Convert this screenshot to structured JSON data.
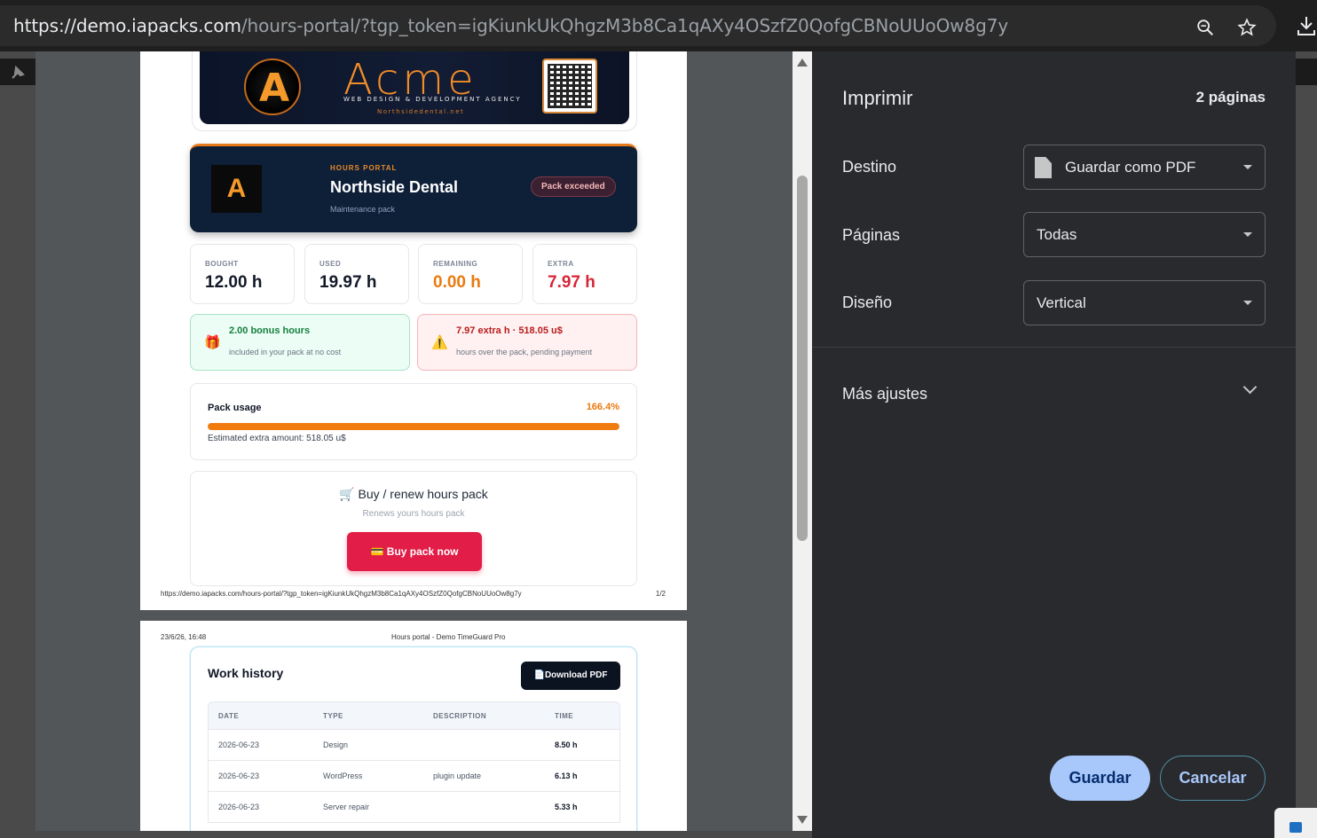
{
  "browser": {
    "url_host": "https://demo.iapacks.com",
    "url_rest": "/hours-portal/?tgp_token=igKiunkUkQhgzM3b8Ca1qAXy4OSzfZ0QofgCBNoUUoOw8g7y"
  },
  "print_dialog": {
    "title": "Imprimir",
    "page_count": "2 páginas",
    "destination_label": "Destino",
    "destination_value": "Guardar como PDF",
    "pages_label": "Páginas",
    "pages_value": "Todas",
    "layout_label": "Diseño",
    "layout_value": "Vertical",
    "more_settings": "Más ajustes",
    "save_button": "Guardar",
    "cancel_button": "Cancelar"
  },
  "preview": {
    "banner": {
      "brand": "Acme",
      "tagline": "WEB DESIGN & DEVELOPMENT AGENCY",
      "site": "Northsidedental.net"
    },
    "portal": {
      "eyebrow": "HOURS PORTAL",
      "client": "Northside Dental",
      "subtitle": "Maintenance pack",
      "badge": "Pack exceeded"
    },
    "stats": [
      {
        "label": "BOUGHT",
        "value": "12.00 h"
      },
      {
        "label": "USED",
        "value": "19.97 h"
      },
      {
        "label": "REMAINING",
        "value": "0.00 h"
      },
      {
        "label": "EXTRA",
        "value": "7.97 h"
      }
    ],
    "bonus_note": {
      "title": "2.00 bonus hours",
      "detail": "included in your pack at no cost"
    },
    "extra_note": {
      "title": "7.97 extra h · 518.05 u$",
      "detail": "hours over the pack, pending payment"
    },
    "usage": {
      "label": "Pack usage",
      "percent_text": "166.4%",
      "fill_fraction": 1.0,
      "estimate": "Estimated extra amount: 518.05 u$"
    },
    "buy": {
      "title": "Buy / renew hours pack",
      "subtitle": "Renews yours hours pack",
      "button": "Buy pack now"
    },
    "page1_footer_url": "https://demo.iapacks.com/hours-portal/?tgp_token=igKiunkUkQhgzM3b8Ca1qAXy4OSzfZ0QofgCBNoUUoOw8g7y",
    "page1_footer_page": "1/2",
    "page2_header_date": "23/6/26, 16:48",
    "page2_header_title": "Hours portal - Demo TimeGuard Pro",
    "history": {
      "title": "Work history",
      "download_button": "Download PDF",
      "columns": [
        "DATE",
        "TYPE",
        "DESCRIPTION",
        "TIME"
      ],
      "rows": [
        {
          "date": "2026-06-23",
          "type": "Design",
          "description": "",
          "time": "8.50 h"
        },
        {
          "date": "2026-06-23",
          "type": "WordPress",
          "description": "plugin update",
          "time": "6.13 h"
        },
        {
          "date": "2026-06-23",
          "type": "Server repair",
          "description": "",
          "time": "5.33 h"
        }
      ]
    }
  }
}
